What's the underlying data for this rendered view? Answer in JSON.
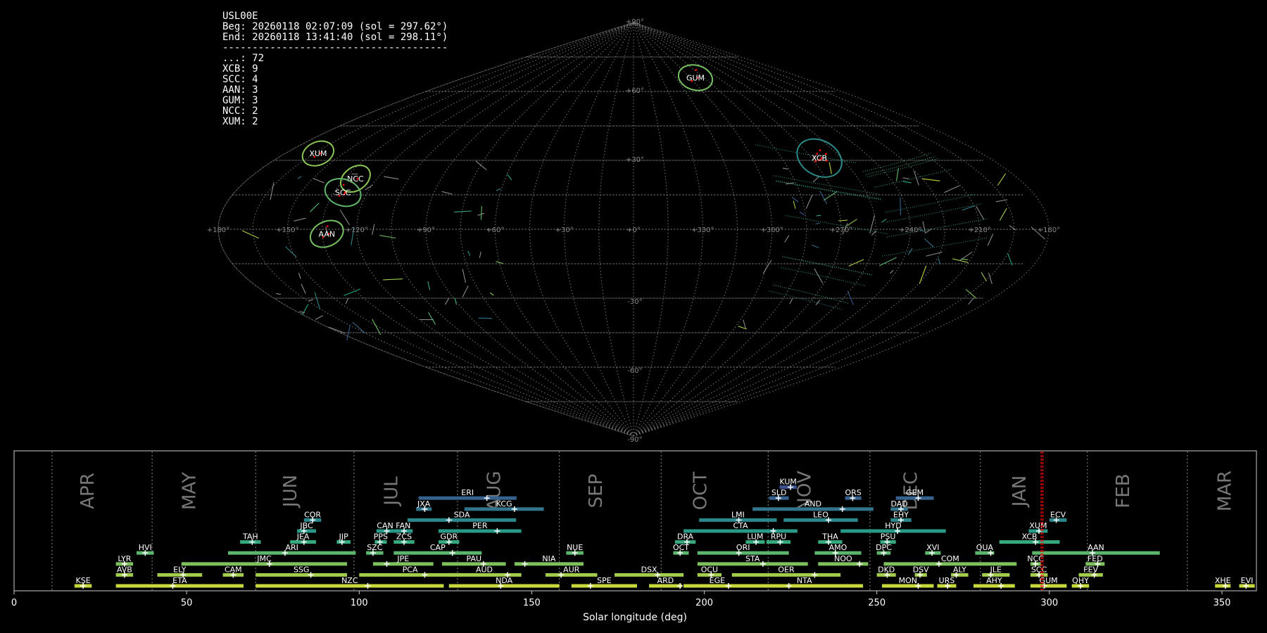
{
  "stats_lines": [
    "USL00E",
    "Beg: 20260118 02:07:09 (sol = 297.62°)",
    "End: 20260118 13:41:40 (sol = 298.11°)",
    "--------------------------------------",
    "...: 72",
    "XCB: 9",
    "SCC: 4",
    "AAN: 3",
    "GUM: 3",
    "NCC: 2",
    "XUM: 2"
  ],
  "colors": {
    "background": "#000000",
    "grid": "#777777",
    "active_marker": "#ff0000",
    "palette_low": "#3b4f8f",
    "palette_mid": "#25a387",
    "palette_high": "#c6d83a"
  },
  "chart_data": [
    {
      "type": "scatter",
      "projection": "sinusoidal",
      "lon_tick_labels": [
        "+180°",
        "+150°",
        "+120°",
        "+90°",
        "+60°",
        "+30°",
        "+0°",
        "+330°",
        "+300°",
        "+270°",
        "+240°",
        "+210°",
        "+180°"
      ],
      "lat_tick_labels": [
        "+90°",
        "+60°",
        "+30°",
        "-30°",
        "-60°",
        "-90°"
      ],
      "grid": true,
      "showers": [
        {
          "code": "GUM",
          "lon": 294,
          "lat": 66,
          "count": 3
        },
        {
          "code": "XUM",
          "lon": 163,
          "lat": 33,
          "count": 2
        },
        {
          "code": "XCB",
          "lon": 266,
          "lat": 31,
          "count": 9
        },
        {
          "code": "NCC",
          "lon": 130,
          "lat": 22,
          "count": 2
        },
        {
          "code": "SCC",
          "lon": 131,
          "lat": 16,
          "count": 4
        },
        {
          "code": "AAN",
          "lon": 133,
          "lat": -2,
          "count": 3
        }
      ]
    },
    {
      "type": "bar",
      "xlabel": "Solar longitude (deg)",
      "xlim": [
        0,
        360
      ],
      "x_ticks": [
        "0",
        "50",
        "100",
        "150",
        "200",
        "250",
        "300",
        "350"
      ],
      "grid": true,
      "months": [
        {
          "name": "APR",
          "start": 11
        },
        {
          "name": "MAY",
          "start": 40
        },
        {
          "name": "JUN",
          "start": 70
        },
        {
          "name": "JUL",
          "start": 98.5
        },
        {
          "name": "AUG",
          "start": 128.5
        },
        {
          "name": "SEP",
          "start": 158
        },
        {
          "name": "OCT",
          "start": 187.5
        },
        {
          "name": "NOV",
          "start": 218.5
        },
        {
          "name": "DEC",
          "start": 248
        },
        {
          "name": "JAN",
          "start": 280
        },
        {
          "name": "FEB",
          "start": 311
        },
        {
          "name": "MAR",
          "start": 340
        }
      ],
      "current_sol": [
        297.62,
        298.11
      ],
      "showers": [
        {
          "code": "KUM",
          "start": 221.8,
          "end": 226.8,
          "peak": 225,
          "row": 9
        },
        {
          "code": "ERI",
          "start": 117.2,
          "end": 145.6,
          "peak": 137,
          "row": 8
        },
        {
          "code": "SLD",
          "start": 218.8,
          "end": 224.5,
          "peak": 221.5,
          "row": 8
        },
        {
          "code": "ORS",
          "start": 240.8,
          "end": 245.5,
          "peak": 243,
          "row": 8
        },
        {
          "code": "GEM",
          "start": 255.5,
          "end": 266.5,
          "peak": 262,
          "row": 8
        },
        {
          "code": "JXA",
          "start": 116.5,
          "end": 121,
          "peak": 119,
          "row": 7
        },
        {
          "code": "KCG",
          "start": 130.5,
          "end": 153.5,
          "peak": 145,
          "row": 7
        },
        {
          "code": "AND",
          "start": 214,
          "end": 249,
          "peak": 240,
          "row": 7
        },
        {
          "code": "DAD",
          "start": 254,
          "end": 259,
          "peak": 257,
          "row": 7
        },
        {
          "code": "COR",
          "start": 84,
          "end": 89,
          "peak": 86.5,
          "row": 6
        },
        {
          "code": "SDA",
          "start": 114,
          "end": 145.5,
          "peak": 126,
          "row": 6
        },
        {
          "code": "LMI",
          "start": 198.5,
          "end": 221,
          "peak": 210,
          "row": 6
        },
        {
          "code": "LEO",
          "start": 223,
          "end": 244.5,
          "peak": 236,
          "row": 6
        },
        {
          "code": "EHY",
          "start": 254,
          "end": 260,
          "peak": 257,
          "row": 6
        },
        {
          "code": "ECV",
          "start": 300,
          "end": 305,
          "peak": 302,
          "row": 6
        },
        {
          "code": "JBC",
          "start": 82,
          "end": 87.5,
          "peak": 84,
          "row": 5
        },
        {
          "code": "CAN",
          "start": 105,
          "end": 110,
          "peak": 108,
          "row": 5
        },
        {
          "code": "FAN",
          "start": 110,
          "end": 115.5,
          "peak": 113,
          "row": 5
        },
        {
          "code": "PER",
          "start": 123,
          "end": 147,
          "peak": 140,
          "row": 5
        },
        {
          "code": "CTA",
          "start": 194,
          "end": 227,
          "peak": 220,
          "row": 5
        },
        {
          "code": "HYD",
          "start": 239.5,
          "end": 270,
          "peak": 256,
          "row": 5
        },
        {
          "code": "XUM",
          "start": 294,
          "end": 299.5,
          "peak": 297,
          "row": 5
        },
        {
          "code": "TAH",
          "start": 65.5,
          "end": 71.5,
          "peak": 69,
          "row": 4
        },
        {
          "code": "JEA",
          "start": 80,
          "end": 87.5,
          "peak": 84,
          "row": 4
        },
        {
          "code": "JIP",
          "start": 93.5,
          "end": 97.5,
          "peak": 95,
          "row": 4
        },
        {
          "code": "PPS",
          "start": 104.5,
          "end": 108,
          "peak": 106,
          "row": 4
        },
        {
          "code": "ZCS",
          "start": 110,
          "end": 116,
          "peak": 113,
          "row": 4
        },
        {
          "code": "GDR",
          "start": 123,
          "end": 129,
          "peak": 126,
          "row": 4
        },
        {
          "code": "DRA",
          "start": 191.5,
          "end": 197.5,
          "peak": 195,
          "row": 4
        },
        {
          "code": "LUM",
          "start": 212,
          "end": 217.5,
          "peak": 215,
          "row": 4
        },
        {
          "code": "RPU",
          "start": 218,
          "end": 225,
          "peak": 222,
          "row": 4
        },
        {
          "code": "THA",
          "start": 233,
          "end": 240,
          "peak": 236,
          "row": 4
        },
        {
          "code": "PSU",
          "start": 251,
          "end": 255.5,
          "peak": 253,
          "row": 4
        },
        {
          "code": "XCB",
          "start": 285.5,
          "end": 303,
          "peak": 296,
          "row": 4
        },
        {
          "code": "HVI",
          "start": 35.5,
          "end": 40.5,
          "peak": 38,
          "row": 3
        },
        {
          "code": "ARI",
          "start": 62,
          "end": 99,
          "peak": 78.5,
          "row": 3
        },
        {
          "code": "SZC",
          "start": 102,
          "end": 107,
          "peak": 104,
          "row": 3
        },
        {
          "code": "CAP",
          "start": 110,
          "end": 135.5,
          "peak": 127,
          "row": 3
        },
        {
          "code": "NUE",
          "start": 160,
          "end": 165,
          "peak": 162.5,
          "row": 3
        },
        {
          "code": "OCT",
          "start": 191,
          "end": 195.5,
          "peak": 193,
          "row": 3
        },
        {
          "code": "ORI",
          "start": 198,
          "end": 224.5,
          "peak": 210,
          "row": 3
        },
        {
          "code": "AMO",
          "start": 232,
          "end": 245.5,
          "peak": 238,
          "row": 3
        },
        {
          "code": "DPC",
          "start": 250,
          "end": 254,
          "peak": 252,
          "row": 3
        },
        {
          "code": "XVI",
          "start": 264,
          "end": 268.5,
          "peak": 266,
          "row": 3
        },
        {
          "code": "QUA",
          "start": 278.5,
          "end": 284,
          "peak": 283,
          "row": 3
        },
        {
          "code": "AAN",
          "start": 295,
          "end": 332,
          "peak": 312.5,
          "row": 3
        },
        {
          "code": "LYR",
          "start": 29.5,
          "end": 34.5,
          "peak": 32,
          "row": 2
        },
        {
          "code": "JMC",
          "start": 48.5,
          "end": 96.5,
          "peak": 74,
          "row": 2
        },
        {
          "code": "JPE",
          "start": 104,
          "end": 121.5,
          "peak": 108,
          "row": 2
        },
        {
          "code": "PAU",
          "start": 124,
          "end": 142.5,
          "peak": 136,
          "row": 2
        },
        {
          "code": "NIA",
          "start": 145,
          "end": 165,
          "peak": 148,
          "row": 2
        },
        {
          "code": "STA",
          "start": 198,
          "end": 230,
          "peak": 217,
          "row": 2
        },
        {
          "code": "NOO",
          "start": 233,
          "end": 247.5,
          "peak": 245,
          "row": 2
        },
        {
          "code": "COM",
          "start": 252,
          "end": 290.5,
          "peak": 268,
          "row": 2
        },
        {
          "code": "NCC",
          "start": 294.5,
          "end": 297.5,
          "peak": 296,
          "row": 2
        },
        {
          "code": "FED",
          "start": 310.5,
          "end": 316,
          "peak": 314,
          "row": 2
        },
        {
          "code": "AVB",
          "start": 29.5,
          "end": 34.5,
          "peak": 32,
          "row": 1
        },
        {
          "code": "ELY",
          "start": 41.5,
          "end": 54.5,
          "peak": 49,
          "row": 1
        },
        {
          "code": "CAM",
          "start": 60.5,
          "end": 66.5,
          "peak": 63.5,
          "row": 1
        },
        {
          "code": "SSG",
          "start": 70,
          "end": 96.5,
          "peak": 86,
          "row": 1
        },
        {
          "code": "PCA",
          "start": 100,
          "end": 129.5,
          "peak": 119,
          "row": 1
        },
        {
          "code": "AUD",
          "start": 125.5,
          "end": 147,
          "peak": 143,
          "row": 1
        },
        {
          "code": "AUR",
          "start": 154,
          "end": 169,
          "peak": 158.5,
          "row": 1
        },
        {
          "code": "DSX",
          "start": 174,
          "end": 194,
          "peak": 186.5,
          "row": 1
        },
        {
          "code": "OCU",
          "start": 198,
          "end": 205,
          "peak": 202,
          "row": 1
        },
        {
          "code": "OER",
          "start": 208,
          "end": 239.5,
          "peak": 232,
          "row": 1
        },
        {
          "code": "DKD",
          "start": 250,
          "end": 255.5,
          "peak": 253,
          "row": 1
        },
        {
          "code": "DSV",
          "start": 261,
          "end": 264.5,
          "peak": 262.5,
          "row": 1
        },
        {
          "code": "ALY",
          "start": 271.5,
          "end": 276.5,
          "peak": 273,
          "row": 1
        },
        {
          "code": "JLE",
          "start": 280.5,
          "end": 288.5,
          "peak": 283,
          "row": 1
        },
        {
          "code": "SCC",
          "start": 294.5,
          "end": 299.5,
          "peak": 297,
          "row": 1
        },
        {
          "code": "FEV",
          "start": 308.5,
          "end": 315.5,
          "peak": 313,
          "row": 1
        },
        {
          "code": "KSE",
          "start": 17.5,
          "end": 22.5,
          "peak": 20,
          "row": 0
        },
        {
          "code": "ETA",
          "start": 29.5,
          "end": 66.5,
          "peak": 46,
          "row": 0
        },
        {
          "code": "NZC",
          "start": 70,
          "end": 124.5,
          "peak": 102.5,
          "row": 0
        },
        {
          "code": "NDA",
          "start": 126,
          "end": 158,
          "peak": 141,
          "row": 0
        },
        {
          "code": "SPE",
          "start": 161.5,
          "end": 180.5,
          "peak": 167,
          "row": 0
        },
        {
          "code": "ARD",
          "start": 184,
          "end": 193.5,
          "peak": 193,
          "row": 0
        },
        {
          "code": "EGE",
          "start": 194,
          "end": 213.5,
          "peak": 207,
          "row": 0
        },
        {
          "code": "NTA",
          "start": 212,
          "end": 246,
          "peak": 224.5,
          "row": 0
        },
        {
          "code": "MON",
          "start": 251.5,
          "end": 266.5,
          "peak": 262,
          "row": 0
        },
        {
          "code": "URS",
          "start": 267.5,
          "end": 273,
          "peak": 270.5,
          "row": 0
        },
        {
          "code": "AHY",
          "start": 278,
          "end": 290,
          "peak": 286,
          "row": 0
        },
        {
          "code": "GUM",
          "start": 294.5,
          "end": 305,
          "peak": 298.5,
          "row": 0
        },
        {
          "code": "QHY",
          "start": 306.5,
          "end": 311.5,
          "peak": 309,
          "row": 0
        },
        {
          "code": "XHE",
          "start": 348,
          "end": 352.5,
          "peak": 351,
          "row": 0
        },
        {
          "code": "EVI",
          "start": 355,
          "end": 359.5,
          "peak": 357,
          "row": 0
        }
      ]
    }
  ]
}
